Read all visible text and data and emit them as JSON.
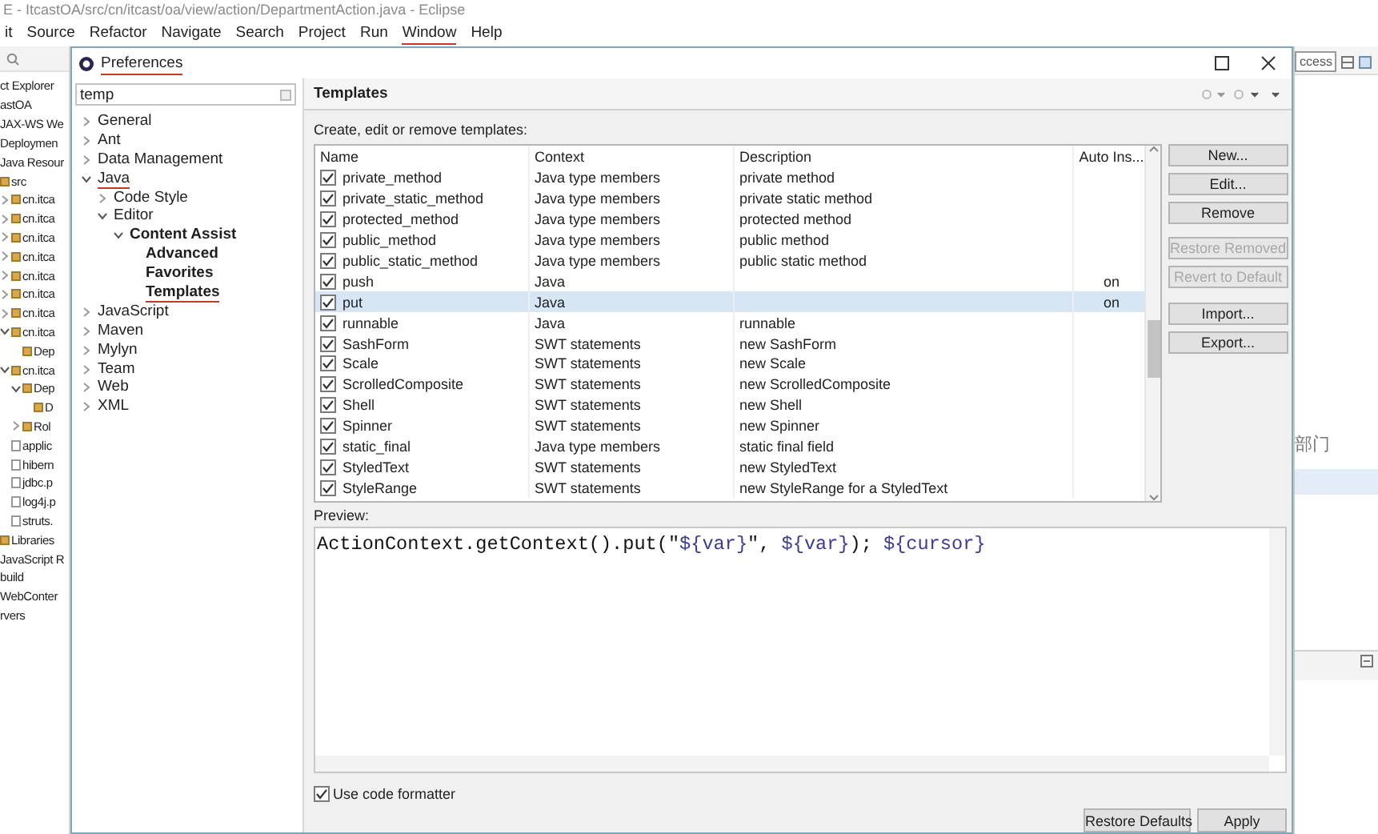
{
  "window": {
    "title": "E - ItcastOA/src/cn/itcast/oa/view/action/DepartmentAction.java - Eclipse"
  },
  "menu": [
    {
      "label": "it",
      "underlined": false
    },
    {
      "label": "Source",
      "underlined": false
    },
    {
      "label": "Refactor",
      "underlined": false
    },
    {
      "label": "Navigate",
      "underlined": false
    },
    {
      "label": "Search",
      "underlined": false
    },
    {
      "label": "Project",
      "underlined": false
    },
    {
      "label": "Run",
      "underlined": false
    },
    {
      "label": "Window",
      "underlined": true
    },
    {
      "label": "Help",
      "underlined": false
    }
  ],
  "explorer": {
    "title": "ct Explorer",
    "items": [
      {
        "label": "astOA",
        "children": [
          {
            "label": "JAX-WS We"
          },
          {
            "label": "Deploymen"
          },
          {
            "label": "Java Resour",
            "children": [
              {
                "label": "src",
                "children": [
                  {
                    "label": "cn.itca",
                    "expanded": false
                  },
                  {
                    "label": "cn.itca",
                    "expanded": false
                  },
                  {
                    "label": "cn.itca",
                    "expanded": false
                  },
                  {
                    "label": "cn.itca",
                    "expanded": false
                  },
                  {
                    "label": "cn.itca",
                    "expanded": false
                  },
                  {
                    "label": "cn.itca",
                    "expanded": false
                  },
                  {
                    "label": "cn.itca",
                    "expanded": false
                  },
                  {
                    "label": "cn.itca",
                    "expanded": true,
                    "children": [
                      {
                        "label": "Dep"
                      }
                    ]
                  },
                  {
                    "label": "cn.itca",
                    "expanded": true,
                    "children": [
                      {
                        "label": "Dep",
                        "expanded": true,
                        "children": [
                          {
                            "label": "D"
                          }
                        ]
                      },
                      {
                        "label": "Rol",
                        "expanded": false
                      }
                    ]
                  },
                  {
                    "label": "applic"
                  },
                  {
                    "label": "hibern"
                  },
                  {
                    "label": "jdbc.p"
                  },
                  {
                    "label": "log4j.p"
                  },
                  {
                    "label": "struts."
                  }
                ]
              },
              {
                "label": "Libraries"
              }
            ]
          },
          {
            "label": "JavaScript R"
          },
          {
            "label": "build"
          },
          {
            "label": "WebConter"
          }
        ]
      },
      {
        "label": "rvers"
      }
    ]
  },
  "preferences": {
    "title": "Preferences",
    "title_underlined": true,
    "filter": "temp",
    "page_title": "Templates",
    "description": "Create, edit or remove templates:",
    "tree": [
      {
        "label": "General",
        "expanded": false,
        "matched": false,
        "underlined": false
      },
      {
        "label": "Ant",
        "expanded": false,
        "matched": false,
        "underlined": false
      },
      {
        "label": "Data Management",
        "expanded": false,
        "matched": false,
        "underlined": false
      },
      {
        "label": "Java",
        "expanded": true,
        "matched": false,
        "underlined": true,
        "children": [
          {
            "label": "Code Style",
            "expanded": false,
            "matched": false,
            "underlined": false
          },
          {
            "label": "Editor",
            "expanded": true,
            "matched": false,
            "underlined": false,
            "children": [
              {
                "label": "Content Assist",
                "expanded": true,
                "matched": true,
                "underlined": false,
                "children": [
                  {
                    "label": "Advanced",
                    "matched": true,
                    "underlined": false
                  },
                  {
                    "label": "Favorites",
                    "matched": true,
                    "underlined": false
                  },
                  {
                    "label": "Templates",
                    "matched": true,
                    "underlined": true
                  }
                ]
              }
            ]
          }
        ]
      },
      {
        "label": "JavaScript",
        "expanded": false,
        "matched": false,
        "underlined": false
      },
      {
        "label": "Maven",
        "expanded": false,
        "matched": false,
        "underlined": false
      },
      {
        "label": "Mylyn",
        "expanded": false,
        "matched": false,
        "underlined": false
      },
      {
        "label": "Team",
        "expanded": false,
        "matched": false,
        "underlined": false
      },
      {
        "label": "Web",
        "expanded": false,
        "matched": false,
        "underlined": false
      },
      {
        "label": "XML",
        "expanded": false,
        "matched": false,
        "underlined": false
      }
    ]
  },
  "templates": {
    "columns": [
      "Name",
      "Context",
      "Description",
      "Auto Ins..."
    ],
    "rows": [
      {
        "name": "private_method",
        "context": "Java type members",
        "description": "private method",
        "checked": true,
        "selected": false
      },
      {
        "name": "private_static_method",
        "context": "Java type members",
        "description": "private static method",
        "checked": true,
        "selected": false
      },
      {
        "name": "protected_method",
        "context": "Java type members",
        "description": "protected method",
        "checked": true,
        "selected": false
      },
      {
        "name": "public_method",
        "context": "Java type members",
        "description": "public method",
        "checked": true,
        "selected": false
      },
      {
        "name": "public_static_method",
        "context": "Java type members",
        "description": "public static method",
        "checked": true,
        "selected": false
      },
      {
        "name": "push",
        "context": "Java",
        "auto_insert": "on",
        "checked": true,
        "selected": false
      },
      {
        "name": "put",
        "context": "Java",
        "auto_insert": "on",
        "checked": true,
        "selected": true
      },
      {
        "name": "runnable",
        "context": "Java",
        "description": "runnable",
        "checked": true,
        "selected": false
      },
      {
        "name": "SashForm",
        "context": "SWT statements",
        "description": "new SashForm",
        "checked": true,
        "selected": false
      },
      {
        "name": "Scale",
        "context": "SWT statements",
        "description": "new Scale",
        "checked": true,
        "selected": false
      },
      {
        "name": "ScrolledComposite",
        "context": "SWT statements",
        "description": "new ScrolledComposite",
        "checked": true,
        "selected": false
      },
      {
        "name": "Shell",
        "context": "SWT statements",
        "description": "new Shell",
        "checked": true,
        "selected": false
      },
      {
        "name": "Spinner",
        "context": "SWT statements",
        "description": "new Spinner",
        "checked": true,
        "selected": false
      },
      {
        "name": "static_final",
        "context": "Java type members",
        "description": "static final field",
        "checked": true,
        "selected": false
      },
      {
        "name": "StyledText",
        "context": "SWT statements",
        "description": "new StyledText",
        "checked": true,
        "selected": false
      },
      {
        "name": "StyleRange",
        "context": "SWT statements",
        "description": "new StyleRange for a StyledText",
        "checked": true,
        "selected": false
      }
    ]
  },
  "buttons": [
    {
      "label": "New...",
      "disabled": false
    },
    {
      "label": "Edit...",
      "disabled": false
    },
    {
      "label": "Remove",
      "disabled": false
    },
    {
      "label": "Restore Removed",
      "disabled": true
    },
    {
      "label": "Revert to Default",
      "disabled": true
    },
    {
      "label": "Import...",
      "disabled": false
    },
    {
      "label": "Export...",
      "disabled": false
    }
  ],
  "preview": {
    "label": "Preview:",
    "code": [
      {
        "kind": "text",
        "text": "ActionContext.getContext().put(\""
      },
      {
        "kind": "variable",
        "text": "${var}"
      },
      {
        "kind": "text",
        "text": "\", "
      },
      {
        "kind": "variable",
        "text": "${var}"
      },
      {
        "kind": "text",
        "text": "); "
      },
      {
        "kind": "variable",
        "text": "${cursor}"
      }
    ]
  },
  "use_code_formatter": {
    "label": "Use code formatter",
    "checked": true
  },
  "footer_buttons": [
    "Restore Defaults",
    "Apply"
  ],
  "editor": {
    "quick_access": "ccess",
    "text": "部门"
  }
}
